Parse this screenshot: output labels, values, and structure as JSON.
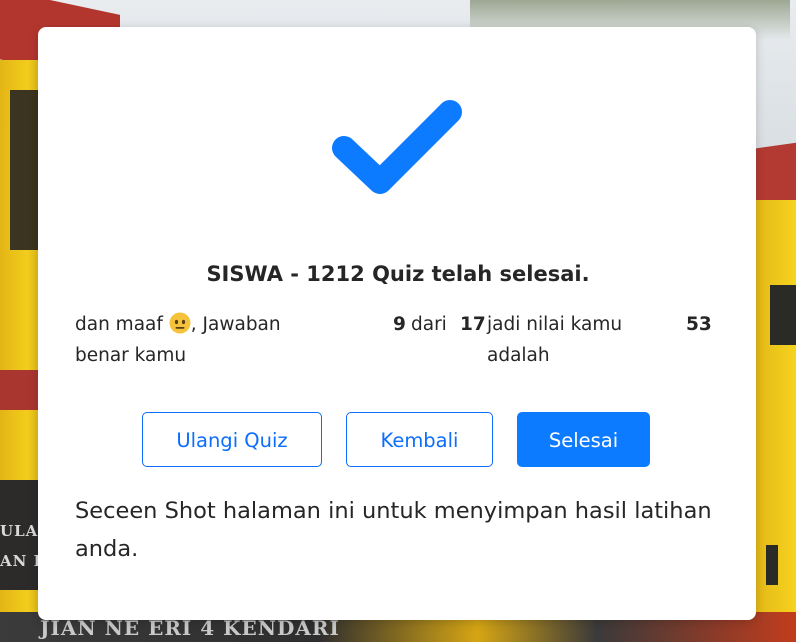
{
  "background": {
    "banner_text_lines": [
      "ULA",
      "AN K"
    ],
    "bottom_sign_text": "JIAN NE  ERI 4 KENDARI"
  },
  "result": {
    "heading": "SISWA - 1212 Quiz telah selesai.",
    "prefix_line1": "dan maaf",
    "emoji": "neutral-face-icon",
    "prefix_line1_after_emoji": ", Jawaban",
    "prefix_line2": "benar kamu",
    "correct_count": "9",
    "of_text": "dari",
    "total_count": "17",
    "score_label_line1": "jadi nilai kamu",
    "score_label_line2": "adalah",
    "score": "53"
  },
  "buttons": {
    "retry_label": "Ulangi Quiz",
    "back_label": "Kembali",
    "finish_label": "Selesai"
  },
  "footer_note": "Seceen Shot halaman ini untuk menyimpan hasil latihan anda.",
  "colors": {
    "primary": "#0d7bff",
    "outline": "#0d6efd",
    "text": "#262626",
    "emoji_face": "#f5c33b"
  }
}
